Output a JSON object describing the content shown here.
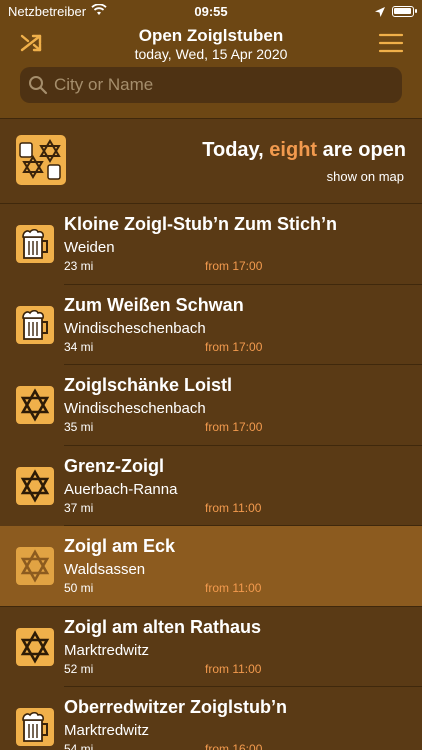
{
  "status_bar": {
    "carrier": "Netzbetreiber",
    "time": "09:55"
  },
  "nav": {
    "title": "Open Zoiglstuben",
    "subtitle": "today, Wed, 15 Apr 2020",
    "left_icon": "shuffle-arrows-icon",
    "right_icon": "hamburger-menu-icon"
  },
  "search": {
    "placeholder": "City or Name",
    "value": ""
  },
  "summary": {
    "prefix": "Today, ",
    "count_word": "eight",
    "suffix": " are open",
    "map_link": "show on map",
    "icon": "zoigl-star-and-mugs-icon"
  },
  "colors": {
    "header_bg": "#6d4714",
    "list_bg": "#5a3a15",
    "selected_bg": "#8c5b1f",
    "accent_orange": "#f29a4e",
    "icon_gold": "#f0b04a"
  },
  "rows": [
    {
      "name": "Kloine Zoigl-Stub’n Zum Stich’n",
      "town": "Weiden",
      "distance": "23 mi",
      "from": "from 17:00",
      "icon": "beer-mug-icon",
      "selected": false
    },
    {
      "name": "Zum Weißen Schwan",
      "town": "Windischeschenbach",
      "distance": "34 mi",
      "from": "from 17:00",
      "icon": "beer-mug-icon",
      "selected": false
    },
    {
      "name": "Zoiglschänke Loistl",
      "town": "Windischeschenbach",
      "distance": "35 mi",
      "from": "from 17:00",
      "icon": "zoigl-star-icon",
      "selected": false
    },
    {
      "name": "Grenz-Zoigl",
      "town": "Auerbach-Ranna",
      "distance": "37 mi",
      "from": "from 11:00",
      "icon": "zoigl-star-icon",
      "selected": false
    },
    {
      "name": "Zoigl am Eck",
      "town": "Waldsassen",
      "distance": "50 mi",
      "from": "from 11:00",
      "icon": "zoigl-star-icon",
      "selected": true
    },
    {
      "name": "Zoigl am alten Rathaus",
      "town": "Marktredwitz",
      "distance": "52 mi",
      "from": "from 11:00",
      "icon": "zoigl-star-icon",
      "selected": false
    },
    {
      "name": "Oberredwitzer Zoiglstub’n",
      "town": "Marktredwitz",
      "distance": "54 mi",
      "from": "from 16:00",
      "icon": "beer-mug-icon",
      "selected": false
    }
  ]
}
